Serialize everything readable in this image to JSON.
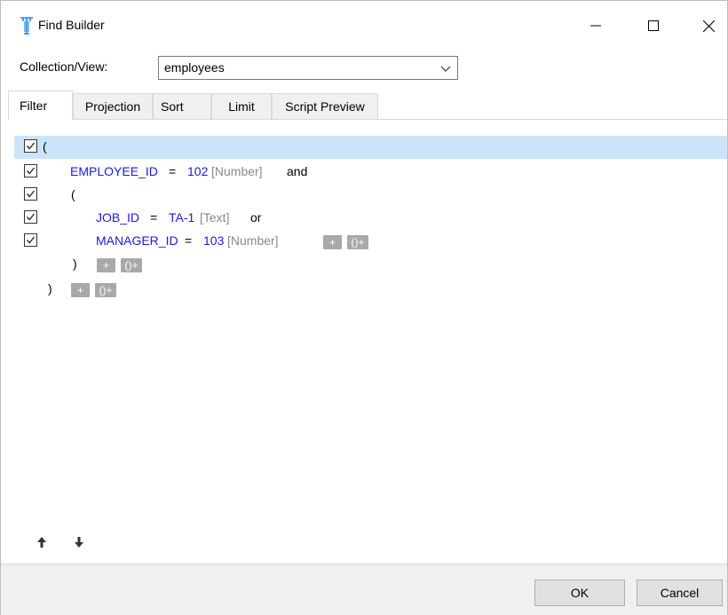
{
  "window": {
    "title": "Find Builder",
    "controls": {
      "minimize": "minimize",
      "maximize": "maximize",
      "close": "close"
    }
  },
  "collection": {
    "label": "Collection/View:",
    "value": "employees"
  },
  "tabs": [
    {
      "label": "Filter",
      "active": true
    },
    {
      "label": "Projection",
      "active": false
    },
    {
      "label": "Sort",
      "active": false
    },
    {
      "label": "Limit",
      "active": false
    },
    {
      "label": "Script Preview",
      "active": false
    }
  ],
  "filter": {
    "root_open": "(",
    "cond1": {
      "field": "EMPLOYEE_ID",
      "op": "=",
      "value": "102",
      "type": "[Number]",
      "join": "and"
    },
    "group_open": "(",
    "cond2": {
      "field": "JOB_ID",
      "op": "=",
      "value": "TA-1",
      "type": "[Text]",
      "join": "or"
    },
    "cond3": {
      "field": "MANAGER_ID",
      "op": "=",
      "value": "103",
      "type": "[Number]"
    },
    "group_close": ")",
    "root_close": ")",
    "add_symbol": "+",
    "group_symbol": "()+"
  },
  "buttons": {
    "ok": "OK",
    "cancel": "Cancel"
  },
  "icons": {
    "app": "find-builder-app-icon",
    "move_up": "arrow-up-icon",
    "move_down": "arrow-down-icon"
  },
  "colors": {
    "field": "#1a1ae6",
    "type_hint": "#8a8a8a",
    "selection": "#cce4f7",
    "mini_button": "#a9a9a9"
  }
}
